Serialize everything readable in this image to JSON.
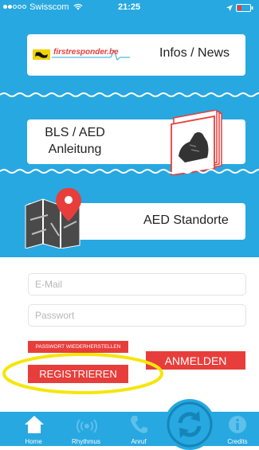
{
  "status_bar": {
    "carrier": "Swisscom",
    "time": "21:25"
  },
  "menu": {
    "infos": {
      "logo_text": "firstresponder.be",
      "label": "Infos / News"
    },
    "bls": {
      "label_line1": "BLS / AED",
      "label_line2": "Anleitung"
    },
    "aed": {
      "label": "AED Standorte"
    }
  },
  "login": {
    "email_placeholder": "E-Mail",
    "password_placeholder": "Passwort",
    "reset_label": "PASSWORT WIEDERHERSTELLEN",
    "login_label": "ANMELDEN",
    "register_label": "REGISTRIEREN"
  },
  "tabs": [
    {
      "label": "Home",
      "icon": "home-icon"
    },
    {
      "label": "Rhythmus",
      "icon": "heartbeat-icon"
    },
    {
      "label": "Anruf",
      "icon": "phone-icon"
    },
    {
      "label": "",
      "icon": "refresh-icon"
    },
    {
      "label": "Credits",
      "icon": "info-icon"
    }
  ],
  "colors": {
    "primary_blue": "#27a8e0",
    "accent_red": "#e83e3b",
    "highlight_yellow": "#f5e60a"
  }
}
